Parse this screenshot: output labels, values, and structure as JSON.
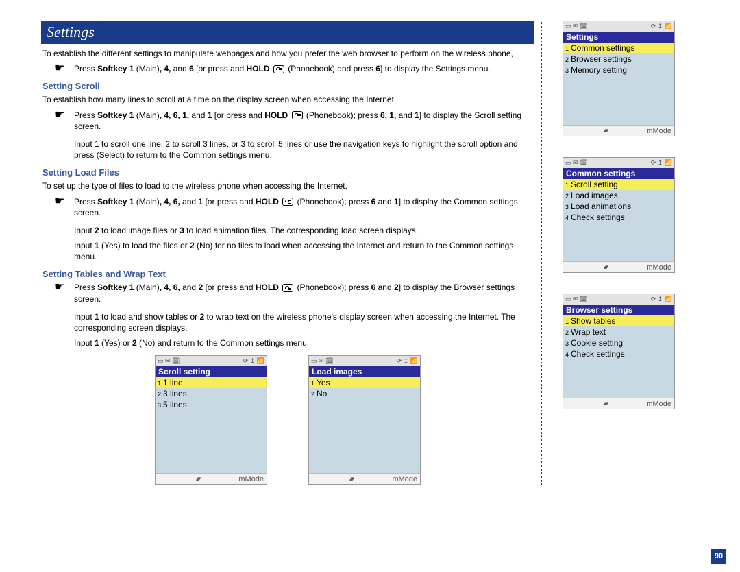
{
  "header": {
    "title": "Settings"
  },
  "intro": "To establish the different settings to manipulate webpages and how you prefer the web browser to perform on the wireless phone,",
  "step1_parts": {
    "a": "Press ",
    "b": "Softkey 1",
    "c": " (Main)",
    "d": ", 4,",
    "e": " and ",
    "f": "6",
    "g": " [or press and ",
    "h": "HOLD",
    "i": " (Phonebook) and press ",
    "j": "6",
    "k": "] to display the Settings menu."
  },
  "scroll": {
    "heading": "Setting Scroll",
    "intro": "To establish how many lines to scroll at a time on the display screen when accessing the Internet,",
    "step_parts": {
      "a": "Press ",
      "b": "Softkey 1",
      "c": " (Main)",
      "d": ", 4, 6, 1,",
      "e": " and ",
      "f": "1",
      "g": " [or press and ",
      "h": "HOLD",
      "i": " (Phonebook); press ",
      "j": "6, 1,",
      "k": " and ",
      "l": "1",
      "m": "] to display the Scroll setting screen."
    },
    "cont": "Input 1 to scroll one line, 2 to scroll 3 lines, or 3 to scroll 5 lines or use the navigation keys to highlight the scroll option and press  (Select) to return to the Common settings menu."
  },
  "load": {
    "heading": "Setting Load Files",
    "intro": "To set up the type of files to load to the wireless phone when accessing the Internet,",
    "step_parts": {
      "a": "Press ",
      "b": "Softkey 1",
      "c": " (Main)",
      "d": ", 4, 6,",
      "e": " and ",
      "f": "1",
      "g": " [or press and ",
      "h": "HOLD",
      "i": " (Phonebook); press ",
      "j": "6",
      "k": " and ",
      "l": "1",
      "m": "] to display the Common settings screen."
    },
    "cont1_parts": {
      "a": "Input ",
      "b": "2",
      "c": " to load image files or ",
      "d": "3",
      "e": " to load animation files. The corresponding load screen displays."
    },
    "cont2_parts": {
      "a": "Input ",
      "b": "1",
      "c": " (Yes) to load the files or ",
      "d": "2",
      "e": " (No) for no files to load when accessing the Internet and return to the Common settings menu."
    }
  },
  "tables": {
    "heading": "Setting Tables and Wrap Text",
    "step_parts": {
      "a": "Press ",
      "b": "Softkey 1",
      "c": " (Main)",
      "d": ", 4, 6,",
      "e": " and ",
      "f": "2",
      "g": " [or press and ",
      "h": "HOLD",
      "i": " (Phonebook); press ",
      "j": "6",
      "k": " and ",
      "l": "2",
      "m": "] to display the Browser settings screen."
    },
    "cont1_parts": {
      "a": "Input ",
      "b": "1",
      "c": " to load and show tables or ",
      "d": "2",
      "e": " to wrap text on the wireless phone's display screen when accessing the Internet. The corresponding screen displays."
    },
    "cont2_parts": {
      "a": "Input ",
      "b": "1",
      "c": " (Yes) or ",
      "d": "2",
      "e": " (No) and return to the Common settings menu."
    }
  },
  "phones": {
    "soft_label": "mMode",
    "settings": {
      "title": "Settings",
      "items": [
        "Common settings",
        "Browser settings",
        "Memory setting"
      ],
      "selected": 0
    },
    "common": {
      "title": "Common settings",
      "items": [
        "Scroll setting",
        "Load images",
        "Load animations",
        "Check settings"
      ],
      "selected": 0
    },
    "browser": {
      "title": "Browser settings",
      "items": [
        "Show tables",
        "Wrap text",
        "Cookie setting",
        "Check settings"
      ],
      "selected": 0
    },
    "scroll": {
      "title": "Scroll setting",
      "items": [
        "1 line",
        "3 lines",
        "5 lines"
      ],
      "selected": 0
    },
    "loadimg": {
      "title": "Load images",
      "items": [
        "Yes",
        "No"
      ],
      "selected": 0
    }
  },
  "page_number": "90"
}
